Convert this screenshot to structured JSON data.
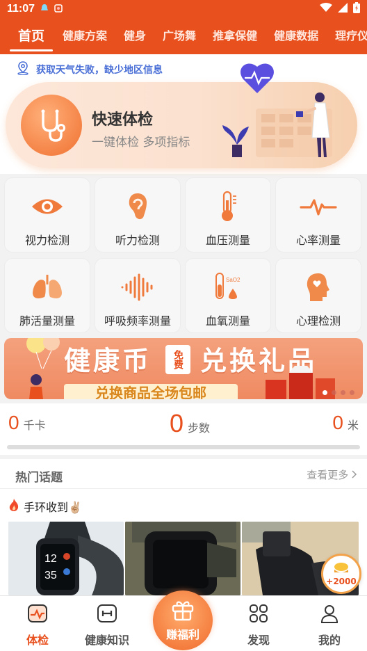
{
  "status_bar": {
    "time": "11:07"
  },
  "tabs": [
    {
      "label": "首页",
      "active": true
    },
    {
      "label": "健康方案"
    },
    {
      "label": "健身"
    },
    {
      "label": "广场舞"
    },
    {
      "label": "推拿保健"
    },
    {
      "label": "健康数据"
    },
    {
      "label": "理疗仪"
    }
  ],
  "weather": {
    "message": "获取天气失败，缺少地区信息",
    "icon": "location-icon"
  },
  "quick_check": {
    "title": "快速体检",
    "subtitle": "一键体检 多项指标"
  },
  "functions": [
    {
      "label": "视力检测",
      "icon": "eye-icon"
    },
    {
      "label": "听力检测",
      "icon": "ear-icon"
    },
    {
      "label": "血压测量",
      "icon": "thermometer-icon"
    },
    {
      "label": "心率测量",
      "icon": "heartbeat-icon"
    },
    {
      "label": "肺活量测量",
      "icon": "lungs-icon"
    },
    {
      "label": "呼吸频率测量",
      "icon": "soundwave-icon"
    },
    {
      "label": "血氧测量",
      "icon": "test-tube-icon",
      "badge": "SaO2"
    },
    {
      "label": "心理检测",
      "icon": "head-heart-icon"
    }
  ],
  "banner": {
    "title": "健康币",
    "tag": "免费",
    "title2": "兑换礼品",
    "subtitle": "兑换商品全场包邮"
  },
  "stats": {
    "calories": {
      "value": "0",
      "unit": "千卡"
    },
    "steps": {
      "value": "0",
      "unit": "步数"
    },
    "distance": {
      "value": "0",
      "unit": "米"
    }
  },
  "topics": {
    "header": "热门话题",
    "more": "查看更多",
    "post_title": "手环收到✌🏼"
  },
  "reward": {
    "amount": "+2000"
  },
  "nav": {
    "checkup": "体检",
    "knowledge": "健康知识",
    "earn": "赚福利",
    "discover": "发现",
    "mine": "我的"
  },
  "colors": {
    "accent": "#e8501e",
    "brand_orange": "#f07030"
  }
}
